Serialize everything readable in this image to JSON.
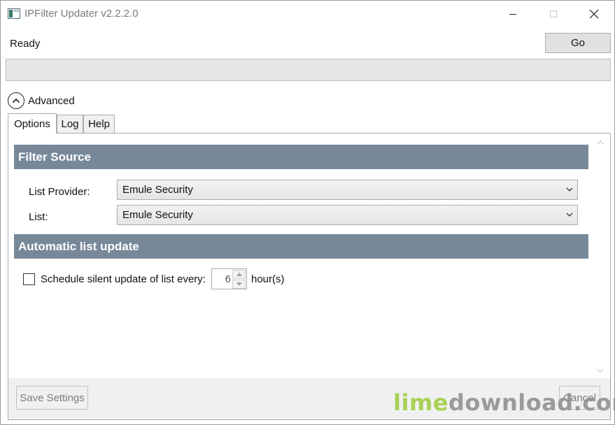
{
  "window": {
    "title": "IPFilter Updater v2.2.2.0",
    "controls": [
      "minimize-icon",
      "maximize-icon",
      "close-icon"
    ]
  },
  "status": {
    "text": "Ready",
    "go_label": "Go",
    "progress_fraction": 0
  },
  "advanced": {
    "label": "Advanced",
    "icon": "chevron-up-circle-icon",
    "expanded": true
  },
  "tabs": [
    {
      "label": "Options",
      "active": true
    },
    {
      "label": "Log",
      "active": false
    },
    {
      "label": "Help",
      "active": false
    }
  ],
  "filter_source": {
    "header": "Filter Source",
    "provider_label": "List Provider:",
    "provider_value": "Emule Security",
    "list_label": "List:",
    "list_value": "Emule Security"
  },
  "auto_update": {
    "header": "Automatic list update",
    "schedule_label": "Schedule silent update of list every:",
    "schedule_checked": false,
    "hours_value": "6",
    "hours_unit": "hour(s)"
  },
  "footer": {
    "save_label": "Save Settings",
    "cancel_label": "Cancel"
  },
  "watermark": {
    "part1": "lime",
    "part2": "download.com"
  },
  "colors": {
    "section_header": "#778899",
    "button_face": "#e1e1e1",
    "progress_track": "#e6e6e6",
    "watermark_green": "#9ccc3c"
  }
}
